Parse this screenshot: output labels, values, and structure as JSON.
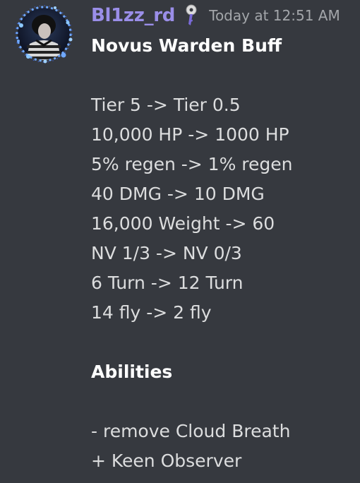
{
  "message": {
    "author": {
      "username": "Bl1zz_rd",
      "role_icon": "key-icon",
      "name_color": "#9a8ee8"
    },
    "timestamp": "Today at 12:51 AM",
    "title": "Novus Warden Buff",
    "changes": [
      "Tier 5 -> Tier 0.5",
      "10,000 HP -> 1000 HP",
      "5% regen -> 1% regen",
      "40 DMG -> 10 DMG",
      "16,000 Weight -> 60",
      "NV 1/3 -> NV 0/3",
      "6 Turn -> 12 Turn",
      "14 fly -> 2 fly"
    ],
    "abilities_heading": "Abilities",
    "abilities": [
      "- remove Cloud Breath",
      "+ Keen Observer"
    ]
  },
  "colors": {
    "background": "#36393f",
    "text": "#dcddde",
    "timestamp": "#a3a6aa"
  }
}
